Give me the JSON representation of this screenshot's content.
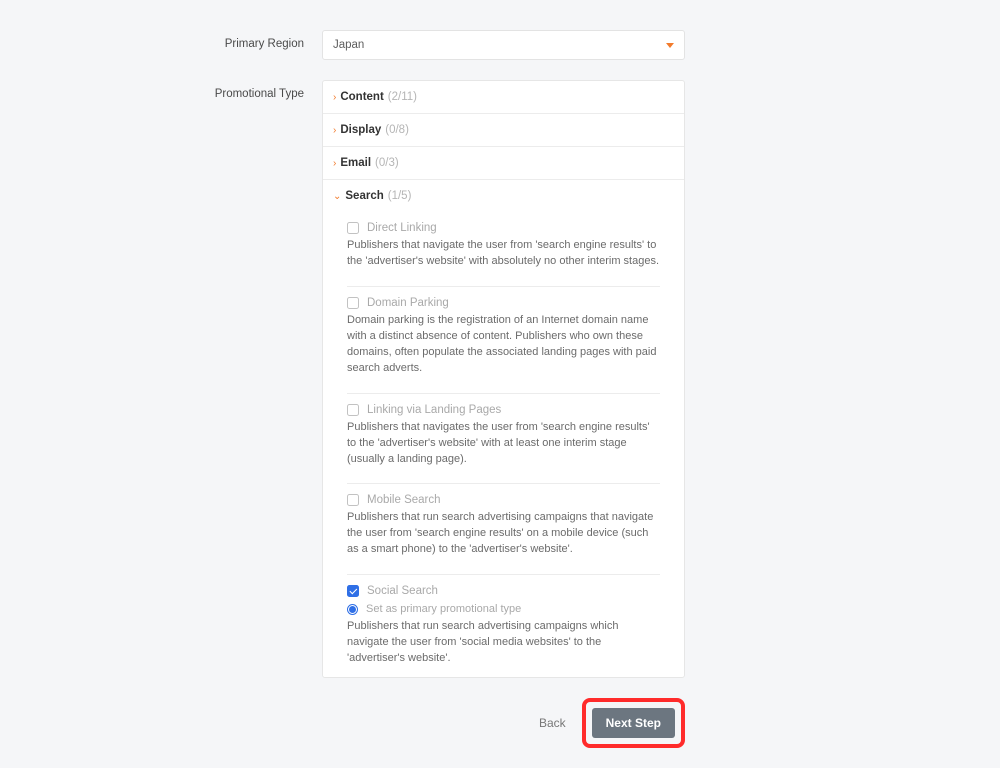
{
  "labels": {
    "primary_region": "Primary Region",
    "promotional_type": "Promotional Type"
  },
  "region": {
    "selected": "Japan"
  },
  "categories": {
    "content": {
      "label": "Content",
      "count": "(2/11)"
    },
    "display": {
      "label": "Display",
      "count": "(0/8)"
    },
    "email": {
      "label": "Email",
      "count": "(0/3)"
    },
    "search": {
      "label": "Search",
      "count": "(1/5)"
    }
  },
  "search_items": {
    "direct_linking": {
      "title": "Direct Linking",
      "desc": "Publishers that navigate the user from 'search engine results' to the 'advertiser's website' with absolutely no other interim stages."
    },
    "domain_parking": {
      "title": "Domain Parking",
      "desc": "Domain parking is the registration of an Internet domain name with a distinct absence of content. Publishers who own these domains, often populate the associated landing pages with paid search adverts."
    },
    "linking_landing": {
      "title": "Linking via Landing Pages",
      "desc": "Publishers that navigates the user from 'search engine results' to the 'advertiser's website' with at least one interim stage (usually a landing page)."
    },
    "mobile_search": {
      "title": "Mobile Search",
      "desc": "Publishers that run search advertising campaigns that navigate the user from 'search engine results' on a mobile device (such as a smart phone) to the 'advertiser's website'."
    },
    "social_search": {
      "title": "Social Search",
      "primary_label": "Set as primary promotional type",
      "desc": "Publishers that run search advertising campaigns which navigate the user from 'social media websites' to the 'advertiser's website'."
    }
  },
  "buttons": {
    "back": "Back",
    "next": "Next Step"
  }
}
